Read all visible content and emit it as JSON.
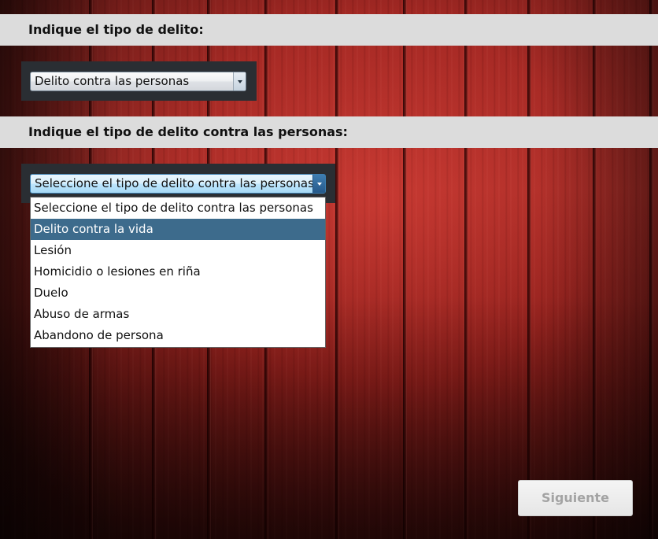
{
  "questions": {
    "crime_type_label": "Indique el tipo de delito:",
    "crime_subtype_label": "Indique el tipo de delito contra las personas:"
  },
  "crime_type_select": {
    "selected": "Delito contra las personas"
  },
  "crime_subtype_select": {
    "selected": "Seleccione el tipo de delito contra las personas",
    "options": [
      "Seleccione el tipo de delito contra las personas",
      "Delito contra la vida",
      "Lesión",
      "Homicidio o lesiones en riña",
      "Duelo",
      "Abuso de armas",
      "Abandono de persona"
    ],
    "highlighted_option": "Delito contra la vida"
  },
  "footer": {
    "next_label": "Siguiente",
    "next_enabled": false
  },
  "colors": {
    "background_wood": "#a72a25",
    "header_band": "#dcdcdc",
    "highlight": "#3d6b8c",
    "disabled_text": "#a3a3a3"
  },
  "icons": {
    "dropdown_arrow": "chevron-down-icon"
  }
}
